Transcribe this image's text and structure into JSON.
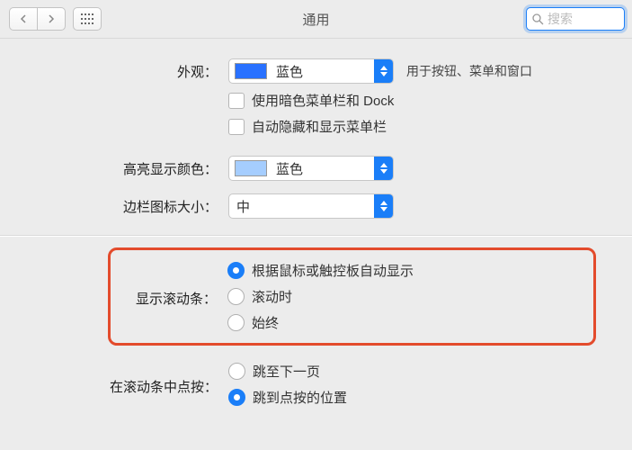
{
  "title": "通用",
  "search_placeholder": "搜索",
  "appearance": {
    "label": "外观：",
    "value": "蓝色",
    "hint": "用于按钮、菜单和窗口"
  },
  "dark_menu": "使用暗色菜单栏和 Dock",
  "auto_hide": "自动隐藏和显示菜单栏",
  "highlight": {
    "label": "高亮显示颜色：",
    "value": "蓝色"
  },
  "sidebar": {
    "label": "边栏图标大小：",
    "value": "中"
  },
  "scroll": {
    "label": "显示滚动条：",
    "o1": "根据鼠标或触控板自动显示",
    "o2": "滚动时",
    "o3": "始终"
  },
  "click": {
    "label": "在滚动条中点按：",
    "o1": "跳至下一页",
    "o2": "跳到点按的位置"
  }
}
